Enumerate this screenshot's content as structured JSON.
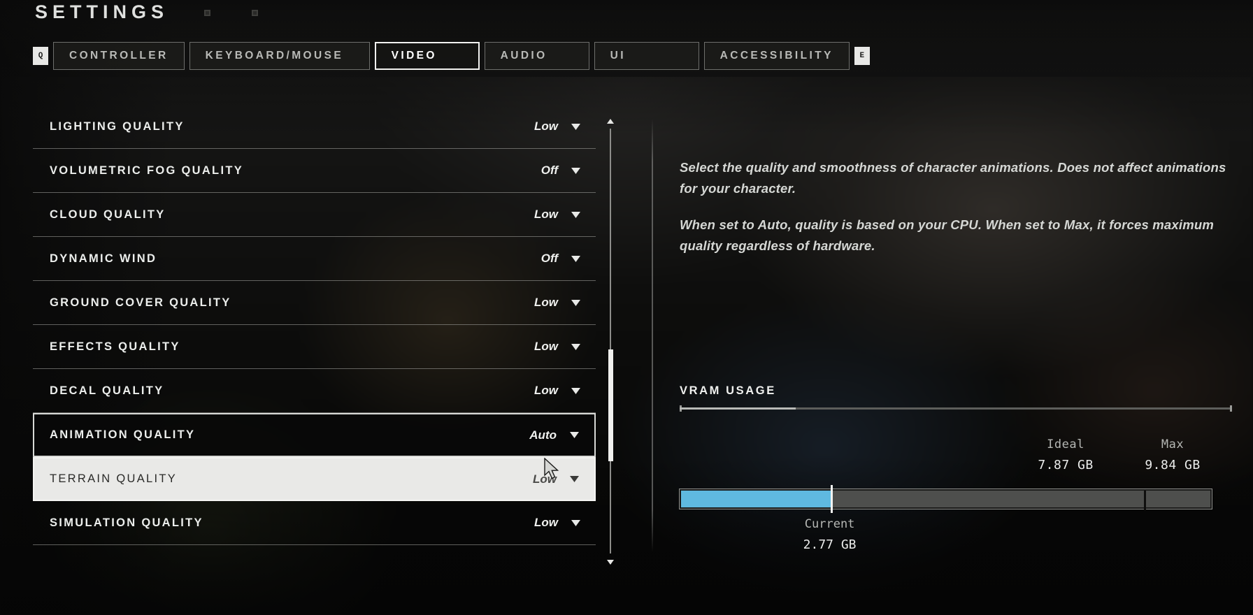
{
  "header": {
    "title": "SETTINGS",
    "back_key": "Q",
    "forward_key": "E"
  },
  "tabs": [
    {
      "label": "CONTROLLER",
      "active": false
    },
    {
      "label": "KEYBOARD/MOUSE",
      "active": false
    },
    {
      "label": "VIDEO",
      "active": true
    },
    {
      "label": "AUDIO",
      "active": false
    },
    {
      "label": "UI",
      "active": false
    },
    {
      "label": "ACCESSIBILITY",
      "active": false
    }
  ],
  "settings": [
    {
      "label": "LIGHTING QUALITY",
      "value": "Low",
      "state": "normal"
    },
    {
      "label": "VOLUMETRIC FOG QUALITY",
      "value": "Off",
      "state": "normal"
    },
    {
      "label": "CLOUD QUALITY",
      "value": "Low",
      "state": "normal"
    },
    {
      "label": "DYNAMIC WIND",
      "value": "Off",
      "state": "normal"
    },
    {
      "label": "GROUND COVER QUALITY",
      "value": "Low",
      "state": "normal"
    },
    {
      "label": "EFFECTS QUALITY",
      "value": "Low",
      "state": "normal"
    },
    {
      "label": "DECAL QUALITY",
      "value": "Low",
      "state": "normal"
    },
    {
      "label": "ANIMATION QUALITY",
      "value": "Auto",
      "state": "selected"
    },
    {
      "label": "TERRAIN QUALITY",
      "value": "Low",
      "state": "hovered"
    },
    {
      "label": "SIMULATION QUALITY",
      "value": "Low",
      "state": "normal"
    }
  ],
  "description": {
    "paragraphs": [
      "Select the quality and smoothness of character animations. Does not affect animations for your character.",
      "When set to Auto, quality is based on your CPU. When set to Max, it forces maximum quality regardless of hardware."
    ]
  },
  "vram": {
    "title": "VRAM USAGE",
    "ideal_label": "Ideal",
    "ideal_value": "7.87 GB",
    "max_label": "Max",
    "max_value": "9.84 GB",
    "current_label": "Current",
    "current_value": "2.77 GB",
    "fill_color": "#5fb9e0",
    "track_color": "#4e4f4d",
    "current_pct": 28.2,
    "ideal_pct": 28.4,
    "max_pct": 87.0
  },
  "icons": {
    "caret": "chevron-down-icon",
    "scroll_up": "scroll-up-arrow-icon",
    "scroll_down": "scroll-down-arrow-icon",
    "cursor": "mouse-cursor-icon"
  }
}
